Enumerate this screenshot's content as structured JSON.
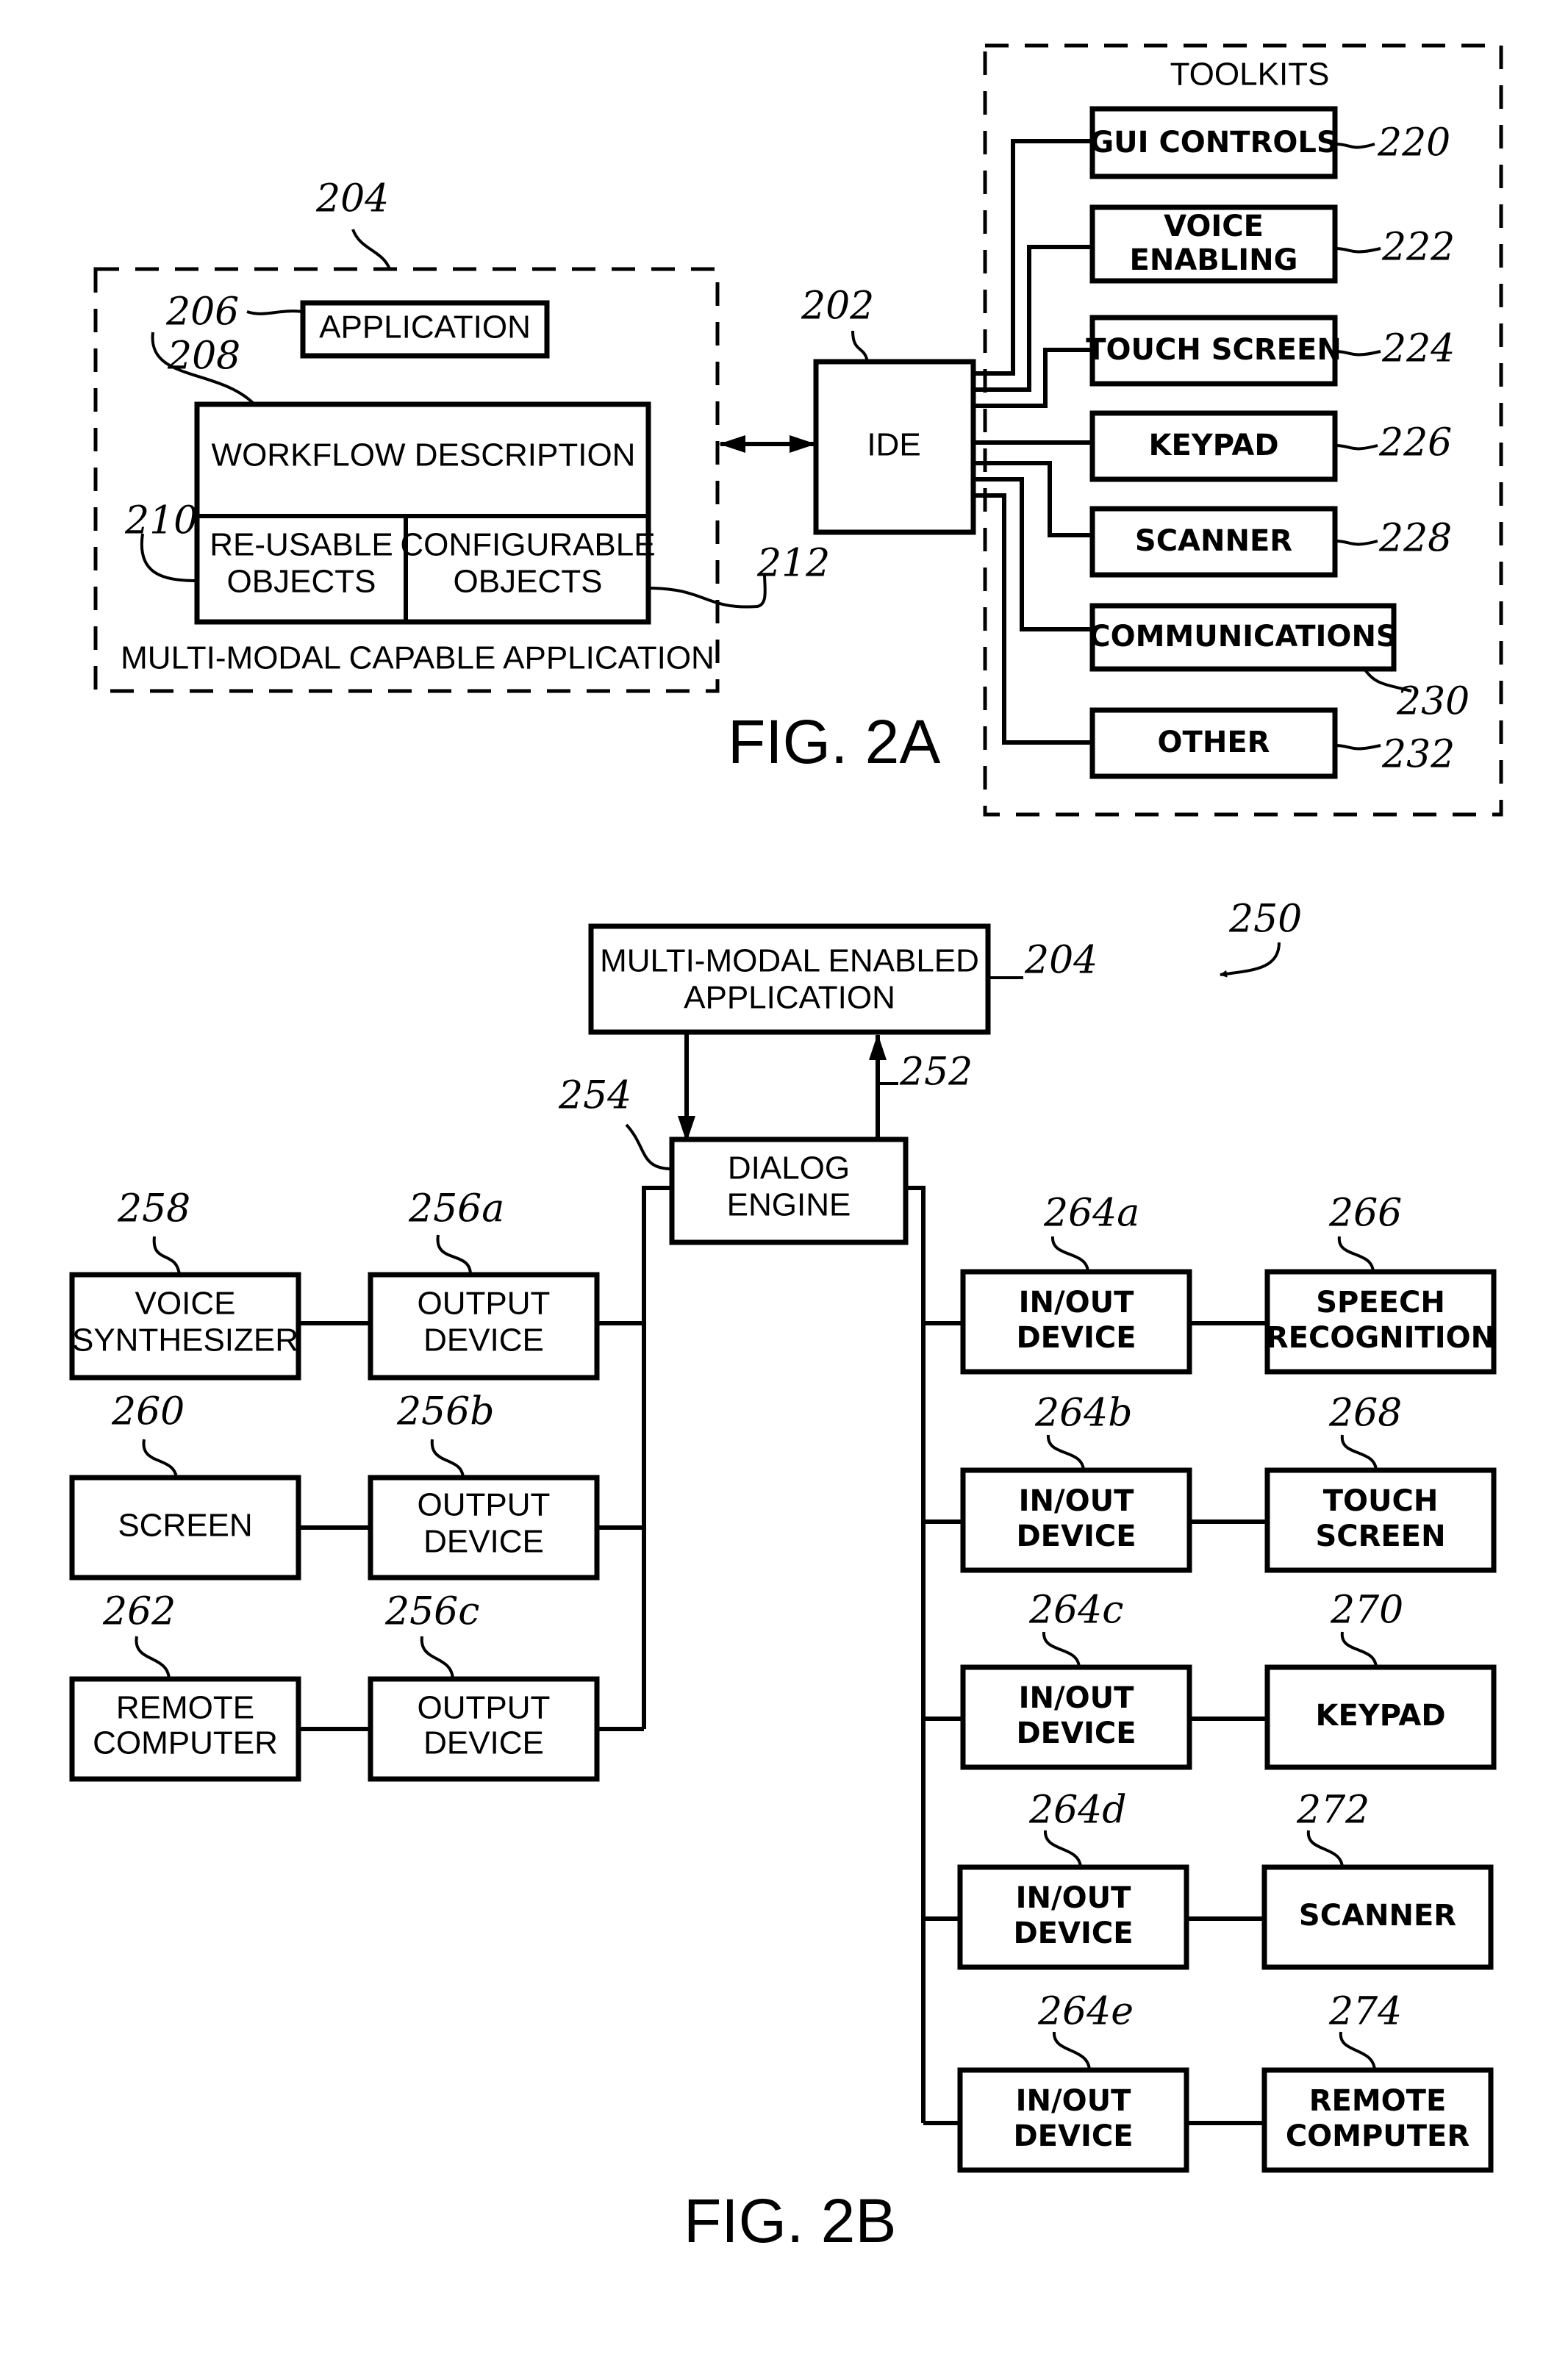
{
  "fig2a": {
    "caption": "FIG. 2A",
    "container_label": "MULTI-MODAL CAPABLE APPLICATION",
    "container_ref": "204",
    "application": {
      "label": "APPLICATION",
      "ref": "206"
    },
    "workflow": {
      "label": "WORKFLOW DESCRIPTION",
      "ref": "208"
    },
    "reusable": {
      "line1": "RE-USABLE",
      "line2": "OBJECTS",
      "ref": "210"
    },
    "configurable": {
      "line1": "CONFIGURABLE",
      "line2": "OBJECTS",
      "ref": "212"
    },
    "ide": {
      "label": "IDE",
      "ref": "202"
    },
    "toolkits": {
      "title": "TOOLKITS",
      "items": [
        {
          "line1": "GUI CONTROLS",
          "line2": "",
          "ref": "220"
        },
        {
          "line1": "VOICE",
          "line2": "ENABLING",
          "ref": "222"
        },
        {
          "line1": "TOUCH SCREEN",
          "line2": "",
          "ref": "224"
        },
        {
          "line1": "KEYPAD",
          "line2": "",
          "ref": "226"
        },
        {
          "line1": "SCANNER",
          "line2": "",
          "ref": "228"
        },
        {
          "line1": "COMMUNICATIONS",
          "line2": "",
          "ref": "230"
        },
        {
          "line1": "OTHER",
          "line2": "",
          "ref": "232"
        }
      ]
    }
  },
  "fig2b": {
    "caption": "FIG. 2B",
    "system_ref": "250",
    "app": {
      "line1": "MULTI-MODAL ENABLED",
      "line2": "APPLICATION",
      "ref": "204"
    },
    "up_arrow_ref": "252",
    "dialog": {
      "line1": "DIALOG",
      "line2": "ENGINE",
      "ref": "254"
    },
    "outputs": [
      {
        "device": {
          "line1": "OUTPUT",
          "line2": "DEVICE",
          "ref": "256a"
        },
        "peer": {
          "line1": "VOICE",
          "line2": "SYNTHESIZER",
          "ref": "258"
        }
      },
      {
        "device": {
          "line1": "OUTPUT",
          "line2": "DEVICE",
          "ref": "256b"
        },
        "peer": {
          "line1": "SCREEN",
          "line2": "",
          "ref": "260"
        }
      },
      {
        "device": {
          "line1": "OUTPUT",
          "line2": "DEVICE",
          "ref": "256c"
        },
        "peer": {
          "line1": "REMOTE",
          "line2": "COMPUTER",
          "ref": "262"
        }
      }
    ],
    "inouts": [
      {
        "device": {
          "line1": "IN/OUT",
          "line2": "DEVICE",
          "ref": "264a"
        },
        "peer": {
          "line1": "SPEECH",
          "line2": "RECOGNITION",
          "ref": "266"
        }
      },
      {
        "device": {
          "line1": "IN/OUT",
          "line2": "DEVICE",
          "ref": "264b"
        },
        "peer": {
          "line1": "TOUCH",
          "line2": "SCREEN",
          "ref": "268"
        }
      },
      {
        "device": {
          "line1": "IN/OUT",
          "line2": "DEVICE",
          "ref": "264c"
        },
        "peer": {
          "line1": "KEYPAD",
          "line2": "",
          "ref": "270"
        }
      },
      {
        "device": {
          "line1": "IN/OUT",
          "line2": "DEVICE",
          "ref": "264d"
        },
        "peer": {
          "line1": "SCANNER",
          "line2": "",
          "ref": "272"
        }
      },
      {
        "device": {
          "line1": "IN/OUT",
          "line2": "DEVICE",
          "ref": "264e"
        },
        "peer": {
          "line1": "REMOTE",
          "line2": "COMPUTER",
          "ref": "274"
        }
      }
    ]
  }
}
